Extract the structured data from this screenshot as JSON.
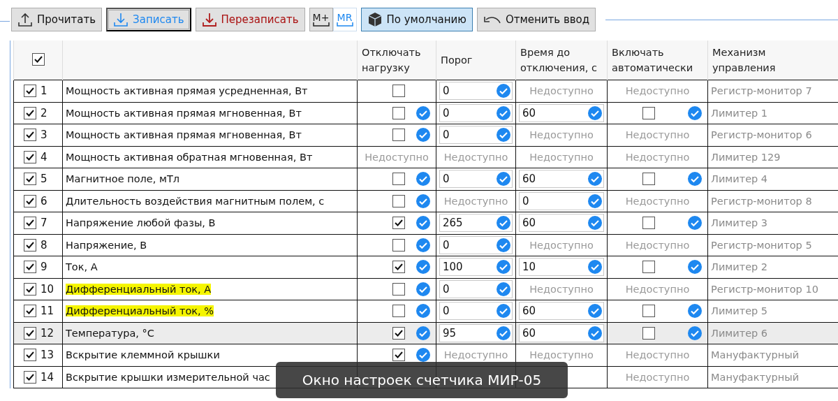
{
  "toolbar": [
    {
      "kind": "read",
      "label": "Прочитать"
    },
    {
      "kind": "write",
      "label": "Записать"
    },
    {
      "kind": "overwrite",
      "label": "Перезаписать"
    },
    {
      "kind": "mplus",
      "label": "M+"
    },
    {
      "kind": "mr",
      "label": "MR"
    },
    {
      "kind": "default",
      "label": "По умолчанию"
    },
    {
      "kind": "undo",
      "label": "Отменить ввод"
    }
  ],
  "table": {
    "all_checked": true,
    "columns": [
      "Отключать нагрузку",
      "Порог",
      "Время до отключения, с",
      "Включать автоматически",
      "Механизм управления"
    ],
    "rows": [
      {
        "checked": true,
        "number": "1",
        "name": "Мощность активная прямая усредненная, Вт",
        "highlighted": false,
        "selected": false,
        "cells": [
          {
            "kind": "check",
            "checked": false,
            "confirmed": false
          },
          {
            "kind": "input",
            "value": "0"
          },
          {
            "kind": "na",
            "text": "Недоступно"
          },
          {
            "kind": "na",
            "text": "Недоступно"
          }
        ],
        "mechanism": "Регистр-монитор 7"
      },
      {
        "checked": true,
        "number": "2",
        "name": "Мощность активная прямая мгновенная, Вт",
        "highlighted": false,
        "selected": false,
        "cells": [
          {
            "kind": "check",
            "checked": false,
            "confirmed": true
          },
          {
            "kind": "input",
            "value": "0"
          },
          {
            "kind": "input",
            "value": "60"
          },
          {
            "kind": "check",
            "checked": false,
            "confirmed": true
          }
        ],
        "mechanism": "Лимитер 1"
      },
      {
        "checked": true,
        "number": "3",
        "name": "Мощность активная прямая мгновенная, Вт",
        "highlighted": false,
        "selected": false,
        "cells": [
          {
            "kind": "check",
            "checked": false,
            "confirmed": true
          },
          {
            "kind": "input",
            "value": "0"
          },
          {
            "kind": "na",
            "text": "Недоступно"
          },
          {
            "kind": "na",
            "text": "Недоступно"
          }
        ],
        "mechanism": "Регистр-монитор 6"
      },
      {
        "checked": true,
        "number": "4",
        "name": "Мощность активная обратная мгновенная, Вт",
        "highlighted": false,
        "selected": false,
        "cells": [
          {
            "kind": "na",
            "text": "Недоступно"
          },
          {
            "kind": "na",
            "text": "Недоступно"
          },
          {
            "kind": "na",
            "text": "Недоступно"
          },
          {
            "kind": "na",
            "text": "Недоступно"
          }
        ],
        "mechanism": "Лимитер 129"
      },
      {
        "checked": true,
        "number": "5",
        "name": "Магнитное поле, мТл",
        "highlighted": false,
        "selected": false,
        "cells": [
          {
            "kind": "check",
            "checked": false,
            "confirmed": true
          },
          {
            "kind": "input",
            "value": "0"
          },
          {
            "kind": "input",
            "value": "60"
          },
          {
            "kind": "check",
            "checked": false,
            "confirmed": true
          }
        ],
        "mechanism": "Лимитер 4"
      },
      {
        "checked": true,
        "number": "6",
        "name": "Длительность воздействия магнитным полем, с",
        "highlighted": false,
        "selected": false,
        "cells": [
          {
            "kind": "check",
            "checked": false,
            "confirmed": true
          },
          {
            "kind": "na",
            "text": "Недоступно"
          },
          {
            "kind": "input",
            "value": "0"
          },
          {
            "kind": "na",
            "text": "Недоступно"
          }
        ],
        "mechanism": "Регистр-монитор 8"
      },
      {
        "checked": true,
        "number": "7",
        "name": "Напряжение любой фазы, В",
        "highlighted": false,
        "selected": false,
        "cells": [
          {
            "kind": "check",
            "checked": true,
            "confirmed": true
          },
          {
            "kind": "input",
            "value": "265"
          },
          {
            "kind": "input",
            "value": "60"
          },
          {
            "kind": "check",
            "checked": false,
            "confirmed": true
          }
        ],
        "mechanism": "Лимитер 3"
      },
      {
        "checked": true,
        "number": "8",
        "name": "Напряжение, В",
        "highlighted": false,
        "selected": false,
        "cells": [
          {
            "kind": "check",
            "checked": false,
            "confirmed": true
          },
          {
            "kind": "input",
            "value": "0"
          },
          {
            "kind": "na",
            "text": "Недоступно"
          },
          {
            "kind": "na",
            "text": "Недоступно"
          }
        ],
        "mechanism": "Регистр-монитор 5"
      },
      {
        "checked": true,
        "number": "9",
        "name": "Ток, А",
        "highlighted": false,
        "selected": false,
        "cells": [
          {
            "kind": "check",
            "checked": true,
            "confirmed": true
          },
          {
            "kind": "input",
            "value": "100"
          },
          {
            "kind": "input",
            "value": "10"
          },
          {
            "kind": "check",
            "checked": false,
            "confirmed": true
          }
        ],
        "mechanism": "Лимитер 2"
      },
      {
        "checked": true,
        "number": "10",
        "name": "Дифференциальный ток, А",
        "highlighted": true,
        "selected": false,
        "cells": [
          {
            "kind": "check",
            "checked": false,
            "confirmed": true
          },
          {
            "kind": "input",
            "value": "0"
          },
          {
            "kind": "na",
            "text": "Недоступно"
          },
          {
            "kind": "na",
            "text": "Недоступно"
          }
        ],
        "mechanism": "Регистр-монитор 10"
      },
      {
        "checked": true,
        "number": "11",
        "name": "Дифференциальный ток, %",
        "highlighted": true,
        "selected": false,
        "cells": [
          {
            "kind": "check",
            "checked": false,
            "confirmed": true
          },
          {
            "kind": "input",
            "value": "0"
          },
          {
            "kind": "input",
            "value": "60"
          },
          {
            "kind": "check",
            "checked": false,
            "confirmed": true
          }
        ],
        "mechanism": "Лимитер 5"
      },
      {
        "checked": true,
        "number": "12",
        "name": "Температура, °С",
        "highlighted": false,
        "selected": true,
        "cells": [
          {
            "kind": "check",
            "checked": true,
            "confirmed": true
          },
          {
            "kind": "input",
            "value": "95"
          },
          {
            "kind": "input",
            "value": "60"
          },
          {
            "kind": "check",
            "checked": false,
            "confirmed": true
          }
        ],
        "mechanism": "Лимитер 6"
      },
      {
        "checked": true,
        "number": "13",
        "name": "Вскрытие клеммной крышки",
        "highlighted": false,
        "selected": false,
        "cells": [
          {
            "kind": "check",
            "checked": true,
            "confirmed": true
          },
          {
            "kind": "na",
            "text": "Недоступно"
          },
          {
            "kind": "na",
            "text": "Недоступно"
          },
          {
            "kind": "na",
            "text": "Недоступно"
          }
        ],
        "mechanism": "Мануфактурный"
      },
      {
        "checked": true,
        "number": "14",
        "name": "Вскрытие крышки измерительной час",
        "highlighted": false,
        "selected": false,
        "cells": [
          {
            "kind": "hidden"
          },
          {
            "kind": "hidden"
          },
          {
            "kind": "hidden"
          },
          {
            "kind": "na",
            "text": "Недоступно"
          }
        ],
        "mechanism": "Мануфактурный"
      }
    ]
  },
  "caption": "Окно настроек счетчика МИР-05"
}
